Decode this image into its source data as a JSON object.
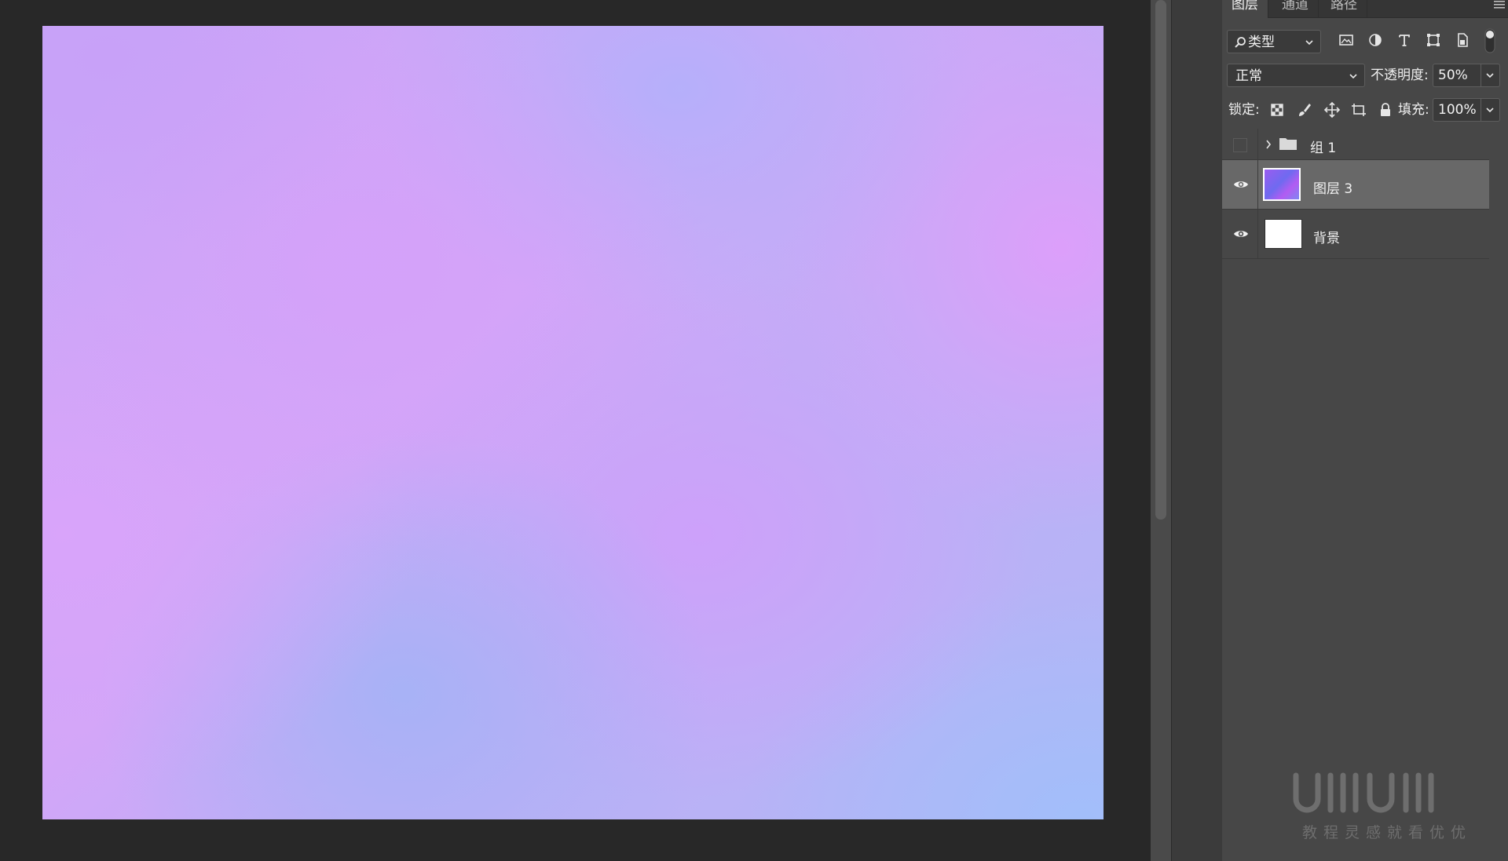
{
  "panel": {
    "tabs": [
      {
        "label": "图层",
        "active": true
      },
      {
        "label": "通道",
        "active": false
      },
      {
        "label": "路径",
        "active": false
      }
    ],
    "filter_select": "类型",
    "blend_mode": "正常",
    "opacity_label": "不透明度:",
    "opacity_value": "50%",
    "lock_label": "锁定:",
    "fill_label": "填充:",
    "fill_value": "100%"
  },
  "layers": [
    {
      "name": "组 1",
      "type": "group",
      "visible": false
    },
    {
      "name": "图层 3",
      "type": "layer",
      "visible": true,
      "selected": true
    },
    {
      "name": "背景",
      "type": "background",
      "visible": true
    }
  ],
  "watermark": {
    "logo_text": "UIIIUIII",
    "caption": "教程灵感就看优优"
  },
  "colors": {
    "panel_bg": "#474747",
    "selected_row": "#686868",
    "workspace_bg": "#282828"
  }
}
